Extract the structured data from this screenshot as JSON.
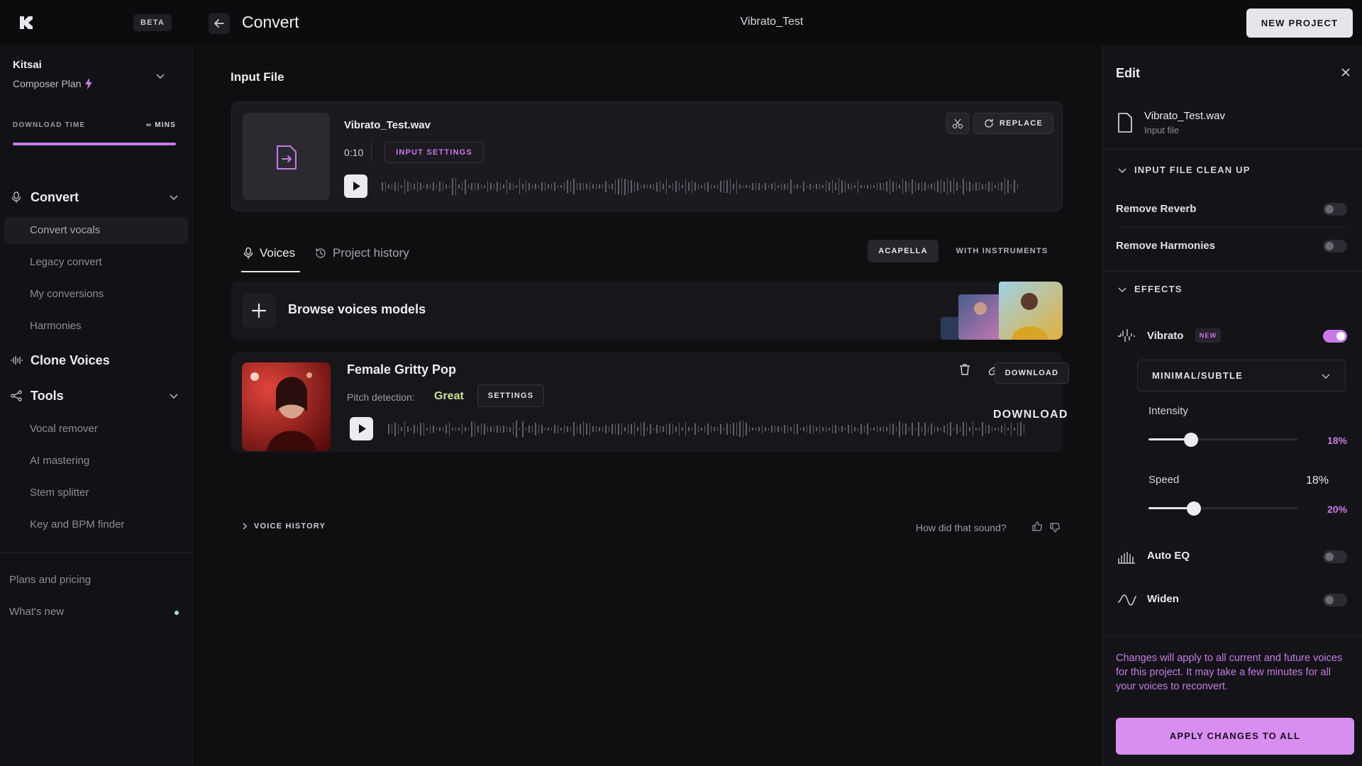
{
  "topbar": {
    "beta": "BETA",
    "page_title": "Convert",
    "project_name": "Vibrato_Test",
    "new_project": "NEW PROJECT"
  },
  "sidebar": {
    "user_name": "Kitsai",
    "plan": "Composer Plan",
    "download_time_label": "DOWNLOAD TIME",
    "download_time_value": "∞ MINS",
    "download_time_fill": 1.0,
    "convert": "Convert",
    "convert_items": [
      "Convert vocals",
      "Legacy convert",
      "My conversions",
      "Harmonies"
    ],
    "clone_voices": "Clone Voices",
    "tools": "Tools",
    "tools_items": [
      "Vocal remover",
      "AI mastering",
      "Stem splitter",
      "Key and BPM finder"
    ],
    "plans": "Plans and pricing",
    "whats_new": "What's new"
  },
  "input": {
    "section_title": "Input File",
    "file_name": "Vibrato_Test.wav",
    "duration": "0:10",
    "input_settings": "INPUT SETTINGS",
    "replace": "REPLACE"
  },
  "tabs": {
    "voices": "Voices",
    "history": "Project history",
    "acapella": "ACAPELLA",
    "with_instruments": "WITH INSTRUMENTS"
  },
  "browse": {
    "label": "Browse voices models"
  },
  "voice_card": {
    "name": "Female Gritty Pop",
    "pitch_label": "Pitch detection:",
    "pitch_value": "Great",
    "settings": "SETTINGS",
    "download": "DOWNLOAD"
  },
  "voice_history": "VOICE HISTORY",
  "feedback": "How did that sound?",
  "edit": {
    "title": "Edit",
    "file_name": "Vibrato_Test.wav",
    "file_sub": "Input file",
    "cleanup_title": "INPUT FILE CLEAN UP",
    "remove_reverb": "Remove Reverb",
    "remove_reverb_on": false,
    "remove_harmonies": "Remove Harmonies",
    "remove_harmonies_on": false,
    "effects_title": "EFFECTS",
    "vibrato": "Vibrato",
    "vibrato_badge": "NEW",
    "vibrato_on": true,
    "preset": "MINIMAL/SUBTLE",
    "intensity_label": "Intensity",
    "intensity_value": "18%",
    "intensity_level": 0.18,
    "speed_label": "Speed",
    "speed_value": "20%",
    "speed_level": 0.2,
    "auto_eq": "Auto EQ",
    "auto_eq_on": false,
    "widen": "Widen",
    "widen_on": false,
    "notice": "Changes will apply to all current and future voices for this project. It may take a few minutes for all your voices to reconvert.",
    "apply": "APPLY CHANGES TO ALL"
  },
  "colors": {
    "accent": "#c77ae6",
    "great": "#c9e68a",
    "background": "#0f0f12"
  }
}
